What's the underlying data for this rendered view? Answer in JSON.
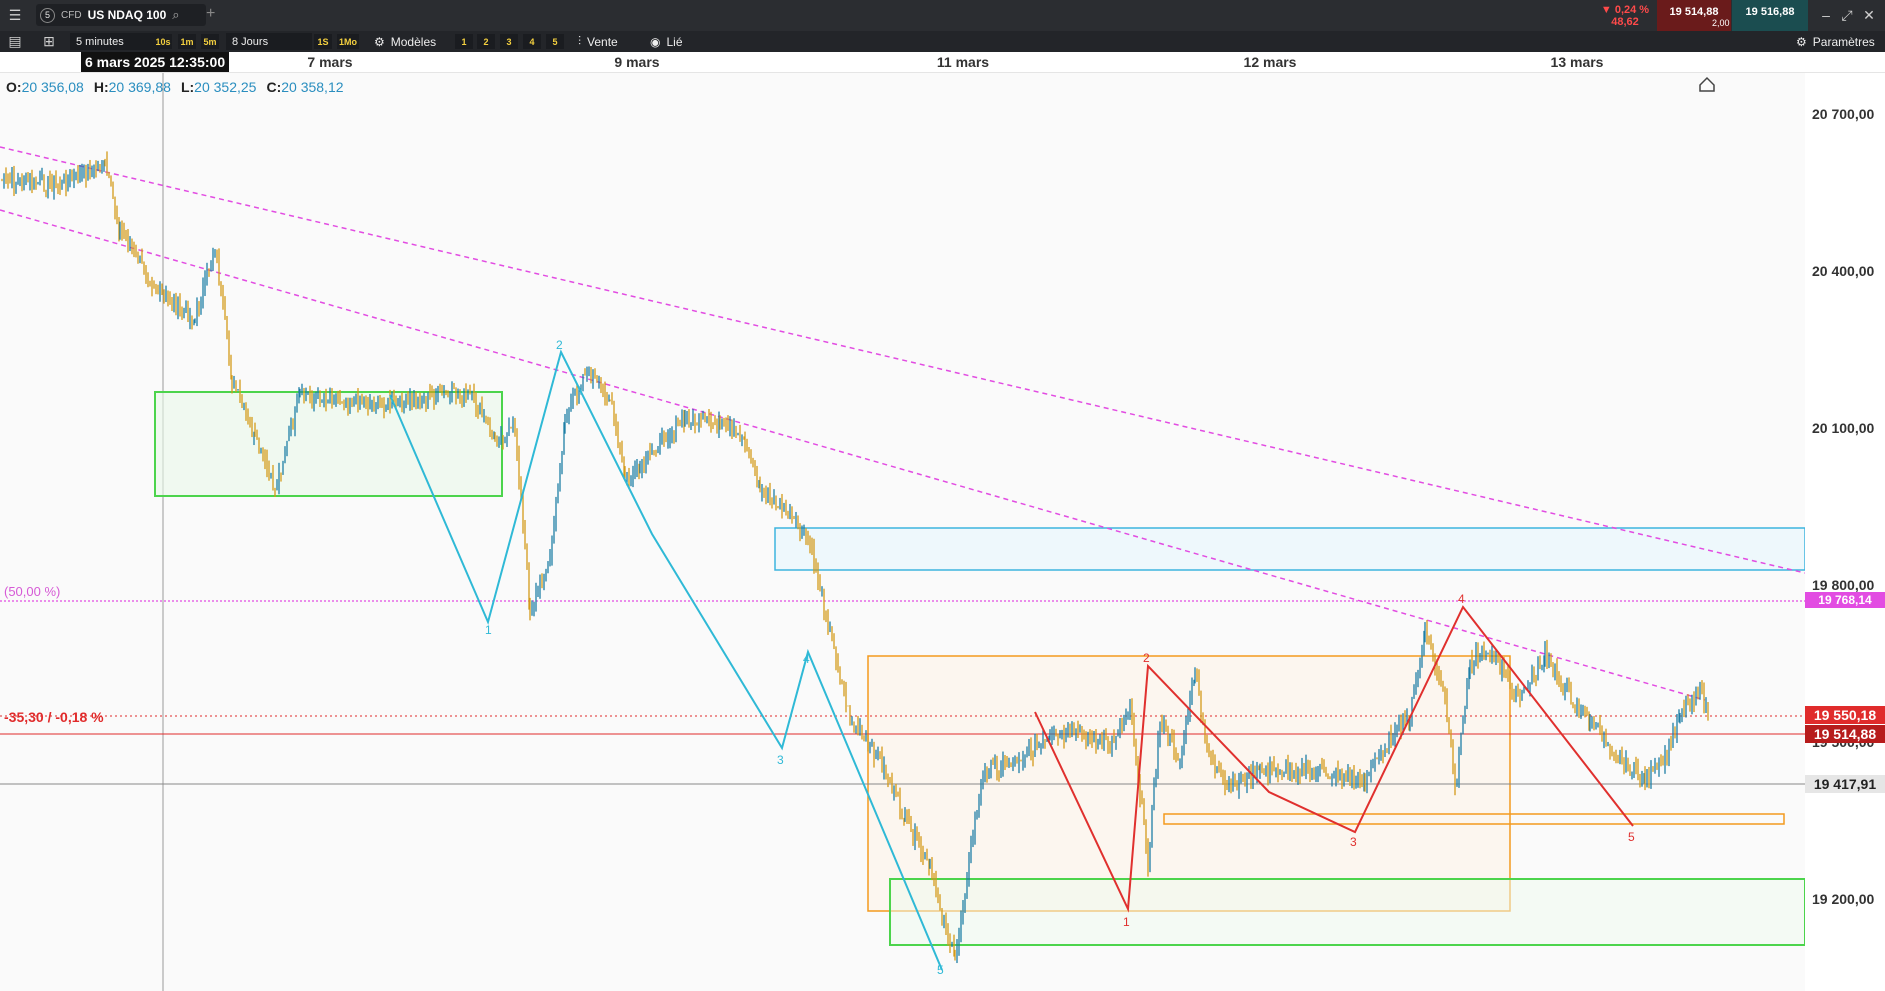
{
  "instrument": {
    "badge_num": "5",
    "type": "CFD",
    "name": "US NDAQ 100"
  },
  "quote": {
    "change_pct": "▼ 0,24 %",
    "change_pts": "48,62",
    "bid": "19 514,88",
    "ask": "19 516,88",
    "spread": "2,00"
  },
  "toolbar": {
    "timeframe": "5 minutes",
    "intervals": [
      "10s",
      "1m",
      "5m"
    ],
    "range": "8 Jours",
    "periods": [
      "1S",
      "1Mo"
    ],
    "models_label": "Modèles",
    "levels": [
      "1",
      "2",
      "3",
      "4",
      "5"
    ],
    "sell_label": "Vente",
    "linked_label": "Lié",
    "settings_label": "Paramètres"
  },
  "dates": {
    "current": "6 mars 2025 12:35:00",
    "labels": [
      "7 mars",
      "9 mars",
      "11 mars",
      "12 mars",
      "13 mars"
    ]
  },
  "ohlc": {
    "o_label": "O:",
    "o": "20 356,08",
    "h_label": "H:",
    "h": "20 369,88",
    "l_label": "L:",
    "l": "20 352,25",
    "c_label": "C:",
    "c": "20 358,12"
  },
  "axis": {
    "ticks": [
      "20 700,00",
      "20 400,00",
      "20 100,00",
      "19 800,00",
      "19 500,00",
      "19 200,00"
    ]
  },
  "markers": {
    "fib_label": "(50,00 %)",
    "fib_price": "19 768,14",
    "variation": "-35,30 / -0,18 %",
    "last_price": "19 550,18",
    "bid_price": "19 514,88",
    "crosshair_price": "19 417,91"
  },
  "waves": {
    "blue": [
      "1",
      "2",
      "3",
      "4",
      "5"
    ],
    "red": [
      "1",
      "2",
      "3",
      "4",
      "5"
    ]
  },
  "colors": {
    "wave_blue": "#2fb9d6",
    "wave_red": "#e0302e",
    "trend": "#e24ce2",
    "zone_green": "#4cd44c",
    "zone_orange": "#f39a1e",
    "zone_blue": "#3db4de",
    "candle_up": "#1e7fa6",
    "candle_down": "#d49a1a"
  }
}
